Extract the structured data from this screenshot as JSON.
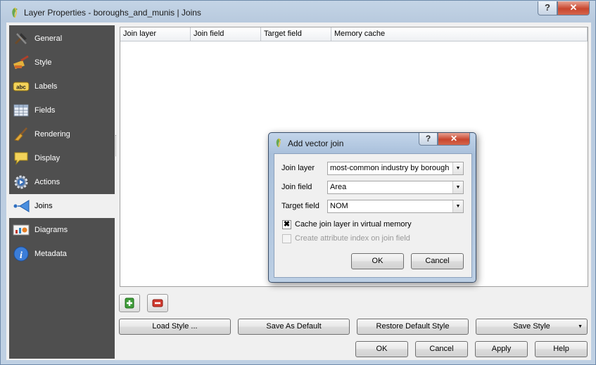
{
  "window": {
    "title": "Layer Properties - boroughs_and_munis | Joins",
    "help_label": "?",
    "close_label": "✕"
  },
  "sidebar": {
    "items": [
      {
        "label": "General",
        "icon": "tools-icon"
      },
      {
        "label": "Style",
        "icon": "paintbrush-icon"
      },
      {
        "label": "Labels",
        "icon": "abc-label-icon"
      },
      {
        "label": "Fields",
        "icon": "table-fields-icon"
      },
      {
        "label": "Rendering",
        "icon": "broom-icon"
      },
      {
        "label": "Display",
        "icon": "speech-bubble-icon"
      },
      {
        "label": "Actions",
        "icon": "gear-play-icon"
      },
      {
        "label": "Joins",
        "icon": "join-icon"
      },
      {
        "label": "Diagrams",
        "icon": "diagram-icon"
      },
      {
        "label": "Metadata",
        "icon": "info-icon"
      }
    ],
    "active": "Joins"
  },
  "joins_table": {
    "columns": [
      "Join layer",
      "Join field",
      "Target field",
      "Memory cache"
    ],
    "rows": []
  },
  "toolbar": {
    "add_icon": "plus-icon",
    "remove_icon": "minus-icon"
  },
  "style_buttons": {
    "load": "Load Style ...",
    "save_default": "Save As Default",
    "restore_default": "Restore Default Style",
    "save": "Save Style"
  },
  "dialog_buttons": {
    "ok": "OK",
    "cancel": "Cancel",
    "apply": "Apply",
    "help": "Help"
  },
  "add_join": {
    "title": "Add vector join",
    "help_label": "?",
    "close_label": "✕",
    "join_layer_label": "Join layer",
    "join_layer_value": "most-common industry by borough",
    "join_field_label": "Join field",
    "join_field_value": "Area",
    "target_field_label": "Target field",
    "target_field_value": "NOM",
    "cache_label": "Cache join layer in virtual memory",
    "cache_checked": true,
    "cache_mark": "✖",
    "index_label": "Create attribute index on join field",
    "index_checked": false,
    "ok": "OK",
    "cancel": "Cancel"
  }
}
